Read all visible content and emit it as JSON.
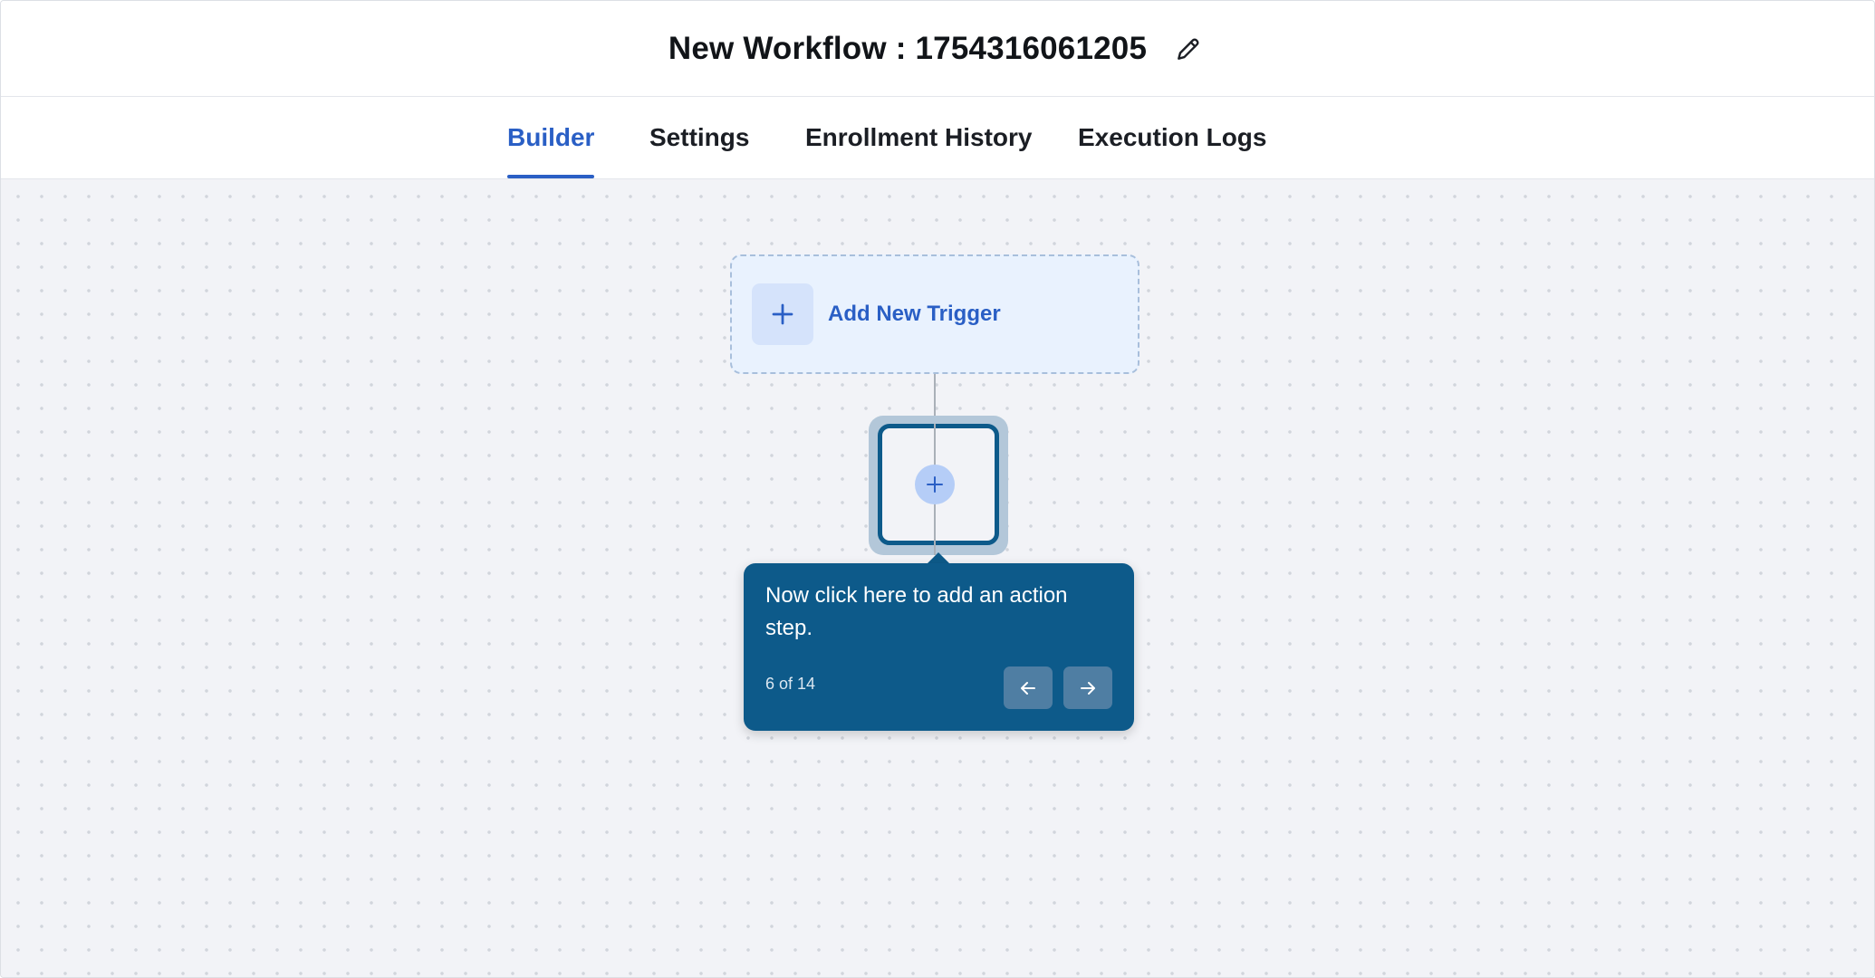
{
  "header": {
    "title": "New Workflow : 1754316061205",
    "edit_icon": "pencil-icon"
  },
  "tabs": [
    {
      "label": "Builder",
      "active": true
    },
    {
      "label": "Settings",
      "active": false
    },
    {
      "label": "Enrollment History",
      "active": false
    },
    {
      "label": "Execution Logs",
      "active": false
    }
  ],
  "builder": {
    "trigger_label": "Add New Trigger",
    "trigger_icon": "plus-icon",
    "add_step_icon": "plus-icon"
  },
  "tour": {
    "message": "Now click here to add an action step.",
    "progress": "6 of 14",
    "prev_icon": "arrow-left-icon",
    "next_icon": "arrow-right-icon"
  },
  "colors": {
    "accent": "#2a5fc5",
    "tooltip_bg": "#0d5a8a",
    "canvas_bg": "#f2f3f7"
  }
}
